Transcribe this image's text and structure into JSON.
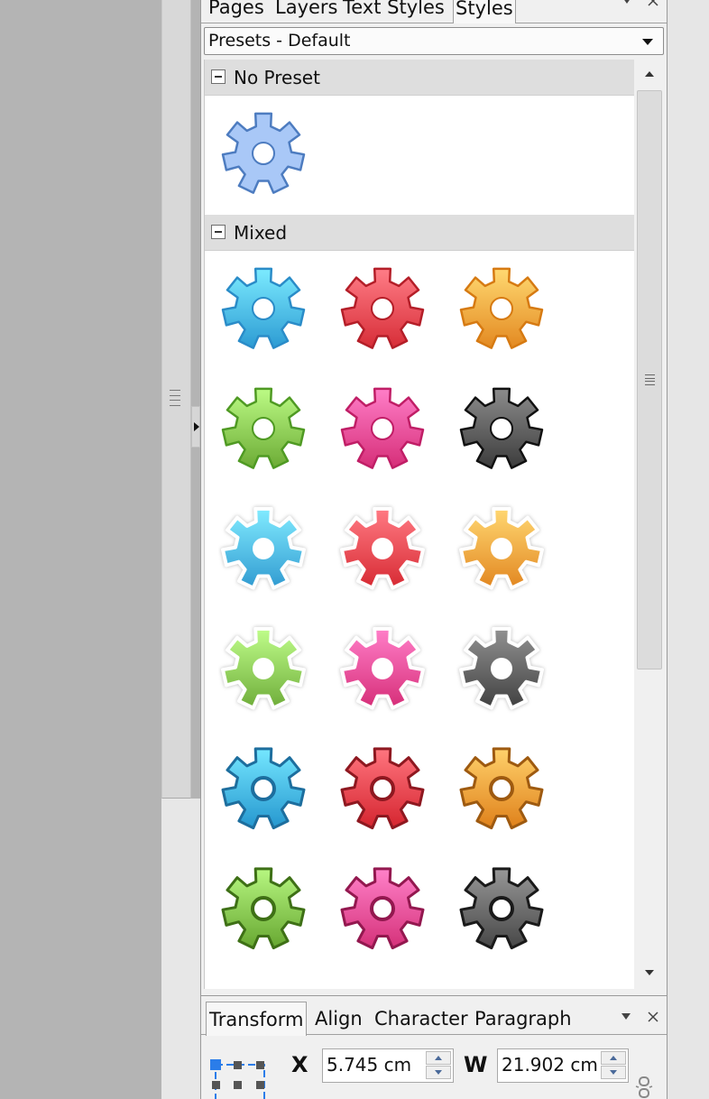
{
  "styles_panel": {
    "tabs": [
      {
        "label": "Pages",
        "active": false
      },
      {
        "label": "Layers",
        "active": false
      },
      {
        "label": "Text Styles",
        "active": false
      },
      {
        "label": "Styles",
        "active": true
      }
    ],
    "menu_icon": "chevron-down-icon",
    "close_icon": "close-icon",
    "preset_select": {
      "value": "Presets - Default"
    },
    "groups": [
      {
        "label": "No Preset",
        "expanded": true
      },
      {
        "label": "Mixed",
        "expanded": true
      }
    ],
    "presets": {
      "no_preset": [
        {
          "style": "flat",
          "color": "#a9c8f7",
          "stroke": "#4d7cc0"
        }
      ],
      "mixed": [
        {
          "style": "gradient",
          "color": "#45b4ec",
          "stroke": "#2a8cc8"
        },
        {
          "style": "gradient",
          "color": "#f04650",
          "stroke": "#b41e28"
        },
        {
          "style": "gradient",
          "color": "#fca23a",
          "stroke": "#d67a12"
        },
        {
          "style": "gradient",
          "color": "#85c44e",
          "stroke": "#4f9a23"
        },
        {
          "style": "gradient",
          "color": "#ef4791",
          "stroke": "#c01e66"
        },
        {
          "style": "gradient",
          "color": "#555555",
          "stroke": "#111111"
        },
        {
          "style": "glow",
          "color": "#4ab4ea",
          "stroke": "#ffffff"
        },
        {
          "style": "glow",
          "color": "#f0434c",
          "stroke": "#ffffff"
        },
        {
          "style": "glow",
          "color": "#fba03a",
          "stroke": "#ffffff"
        },
        {
          "style": "glow",
          "color": "#88c653",
          "stroke": "#ffffff"
        },
        {
          "style": "glow",
          "color": "#ef4791",
          "stroke": "#ffffff"
        },
        {
          "style": "glow",
          "color": "#5a5a5a",
          "stroke": "#ffffff"
        },
        {
          "style": "bevel",
          "color": "#3eb0e8",
          "stroke": "#1d6e9e"
        },
        {
          "style": "bevel",
          "color": "#ee3e48",
          "stroke": "#8e1820"
        },
        {
          "style": "bevel",
          "color": "#f89a34",
          "stroke": "#9e5a10"
        },
        {
          "style": "bevel",
          "color": "#80c04a",
          "stroke": "#3e7016"
        },
        {
          "style": "bevel",
          "color": "#ee4a92",
          "stroke": "#93184f"
        },
        {
          "style": "bevel",
          "color": "#606060",
          "stroke": "#1a1a1a"
        }
      ]
    }
  },
  "transform_panel": {
    "tabs": [
      {
        "label": "Transform",
        "active": true
      },
      {
        "label": "Align",
        "active": false
      },
      {
        "label": "Character",
        "active": false
      },
      {
        "label": "Paragraph",
        "active": false
      }
    ],
    "menu_icon": "chevron-down-icon",
    "close_icon": "close-icon",
    "fields": {
      "x": {
        "label": "X",
        "value": "5.745 cm"
      },
      "w": {
        "label": "W",
        "value": "21.902 cm"
      }
    },
    "reference_point_icon": "reference-point-icon",
    "link_icon": "chain-link-icon"
  }
}
